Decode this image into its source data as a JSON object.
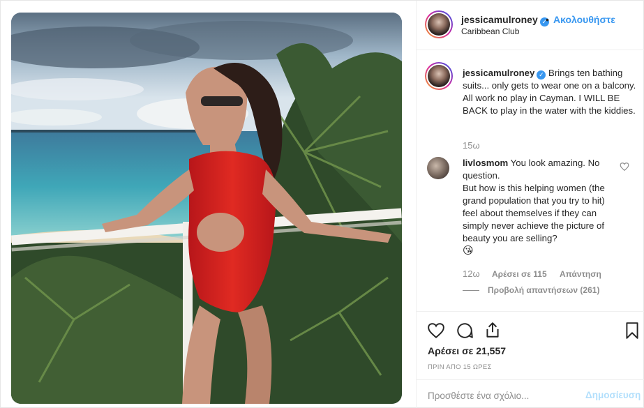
{
  "header": {
    "username": "jessicamulroney",
    "verified_mark": "✓",
    "separator": "•",
    "follow_label": "Ακολουθήστε",
    "location": "Caribbean Club"
  },
  "caption": {
    "username": "jessicamulroney",
    "text": "Brings ten bathing suits... only gets to wear one on a balcony. All work no play in Cayman. I WILL BE BACK to play in the water with the kiddies.",
    "time_ago": "15ω"
  },
  "comment": {
    "username": "livlosmom",
    "line1": "You look amazing. No question.",
    "line2": "But how is this helping women (the grand population that you try to hit) feel about themselves if they can simply never achieve the picture of beauty you are selling?",
    "emoji": "😘",
    "time_ago": "12ω",
    "likes_label": "Αρέσει σε 115",
    "reply_label": "Απάντηση",
    "view_replies_label": "Προβολή απαντήσεων (261)"
  },
  "actions": {
    "icons": [
      "heart-icon",
      "comment-icon",
      "share-icon",
      "bookmark-icon"
    ],
    "likes_total": "Αρέσει σε 21,557",
    "posted_ago": "ΠΡΙΝ ΑΠΟ 15 ΩΡΕΣ"
  },
  "add_comment": {
    "placeholder": "Προσθέστε ένα σχόλιο...",
    "post_label": "Δημοσίευση"
  },
  "colors": {
    "accent": "#3897f0",
    "post_disabled": "#b2dffc",
    "muted": "#8e8e8e",
    "swimsuit": "#d8241f"
  }
}
